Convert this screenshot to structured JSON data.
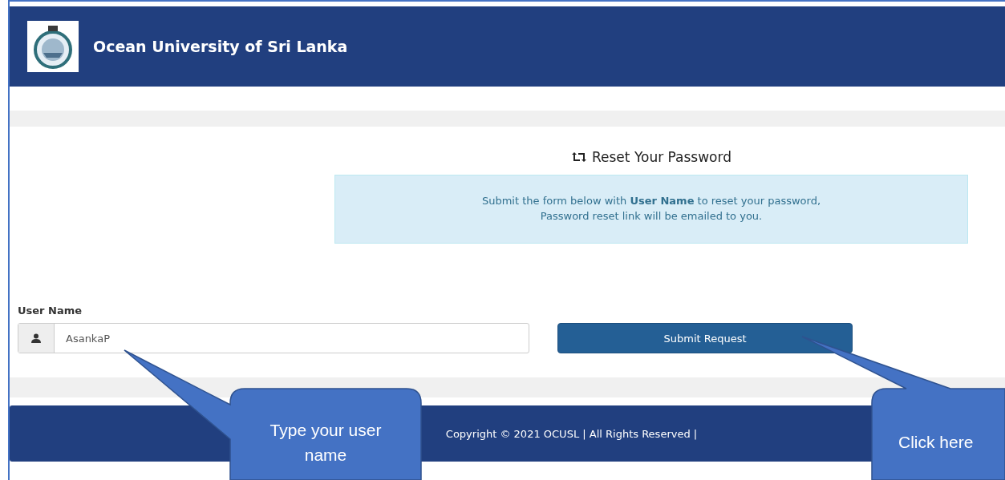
{
  "header": {
    "title": "Ocean University of Sri Lanka"
  },
  "form": {
    "title": "Reset Your Password",
    "notice": [
      "Submit the form below with **User Name** to reset your password,",
      "Password reset link will be emailed to you."
    ],
    "field": {
      "label": "User Name",
      "value": "AsankaP"
    },
    "button": "Submit Request"
  },
  "footer": {
    "text": "Copyright © 2021 OCUSL | All Rights Reserved |"
  },
  "callouts": [
    {
      "text": "Type your user name"
    },
    {
      "text": "Click here"
    }
  ]
}
